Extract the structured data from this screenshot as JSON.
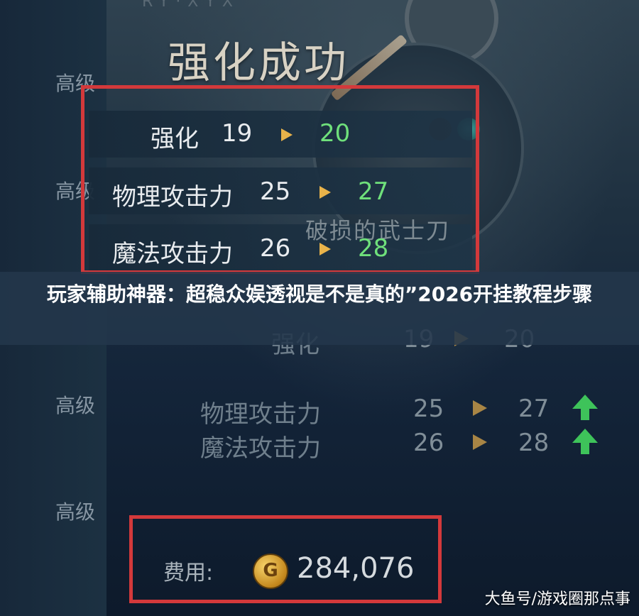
{
  "header": {
    "title": "强化成功",
    "rune_text": "RY·XYX"
  },
  "sidebar": {
    "labels": [
      "高级",
      "高级",
      "高级",
      "高级"
    ]
  },
  "upgrade_result": {
    "rows": [
      {
        "name": "强化",
        "from": "19",
        "to": "20"
      },
      {
        "name": "物理攻击力",
        "from": "25",
        "to": "27"
      },
      {
        "name": "魔法攻击力",
        "from": "26",
        "to": "28"
      }
    ],
    "weapon_name": "破损的武士刀"
  },
  "banner": {
    "text": "玩家辅助神器：超稳众娱透视是不是真的”2026开挂教程步骤"
  },
  "background_panel": {
    "rows": [
      {
        "name": "强化",
        "from": "19",
        "to": "20"
      },
      {
        "name": "物理攻击力",
        "from": "25",
        "to": "27"
      },
      {
        "name": "魔法攻击力",
        "from": "26",
        "to": "28"
      }
    ]
  },
  "cost": {
    "label": "费用:",
    "coin_symbol": "G",
    "amount": "284,076"
  },
  "watermark": {
    "text": "大鱼号/游戏圈那点事"
  },
  "colors": {
    "highlight_box": "#d3393b",
    "increase_value": "#6fe07b",
    "arrow": "#e9b34a",
    "up_indicator": "#3ec35a"
  }
}
